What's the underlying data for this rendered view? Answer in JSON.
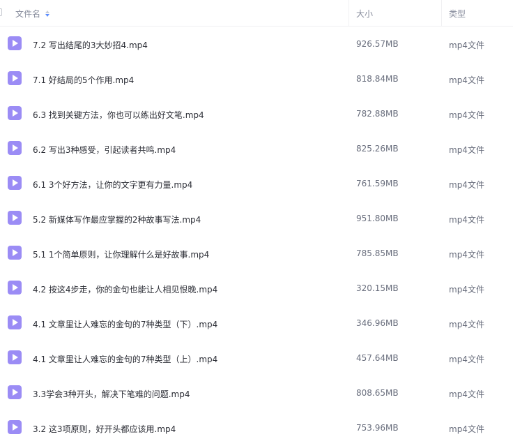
{
  "header": {
    "name": "文件名",
    "size": "大小",
    "type": "类型"
  },
  "files": [
    {
      "name": "7.2 写出结尾的3大妙招4.mp4",
      "size": "926.57MB",
      "type": "mp4文件"
    },
    {
      "name": "7.1 好结局的5个作用.mp4",
      "size": "818.84MB",
      "type": "mp4文件"
    },
    {
      "name": "6.3 找到关键方法，你也可以练出好文笔.mp4",
      "size": "782.88MB",
      "type": "mp4文件"
    },
    {
      "name": "6.2 写出3种感受，引起读者共鸣.mp4",
      "size": "825.26MB",
      "type": "mp4文件"
    },
    {
      "name": "6.1 3个好方法，让你的文字更有力量.mp4",
      "size": "761.59MB",
      "type": "mp4文件"
    },
    {
      "name": "5.2 新媒体写作最应掌握的2种故事写法.mp4",
      "size": "951.80MB",
      "type": "mp4文件"
    },
    {
      "name": "5.1 1个简单原则，让你理解什么是好故事.mp4",
      "size": "785.85MB",
      "type": "mp4文件"
    },
    {
      "name": "4.2 按这4步走，你的金句也能让人相见恨晚.mp4",
      "size": "320.15MB",
      "type": "mp4文件"
    },
    {
      "name": "4.1 文章里让人难忘的金句的7种类型（下）.mp4",
      "size": "346.96MB",
      "type": "mp4文件"
    },
    {
      "name": "4.1 文章里让人难忘的金句的7种类型（上）.mp4",
      "size": "457.64MB",
      "type": "mp4文件"
    },
    {
      "name": "3.3学会3种开头，解决下笔难的问题.mp4",
      "size": "808.65MB",
      "type": "mp4文件"
    },
    {
      "name": "3.2 这3项原则，好开头都应该用.mp4",
      "size": "753.96MB",
      "type": "mp4文件"
    }
  ],
  "icons": {
    "file": "video-file-icon",
    "sort": "sort-icon"
  },
  "colors": {
    "icon": "#9b8cf5",
    "sort_active": "#5b8cff"
  }
}
